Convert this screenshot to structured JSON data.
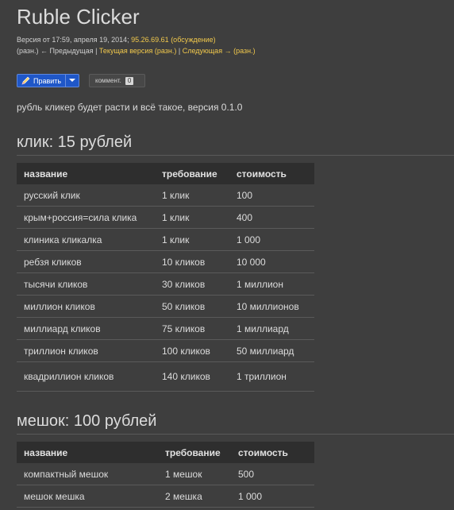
{
  "page": {
    "title": "Ruble Clicker",
    "revision": {
      "prefix": "Версия от 17:59, апреля 19, 2014; ",
      "ip": "95.26.69.61",
      "talk": "(обсуждение)",
      "diff_label": "(разн.)",
      "prev_label": "← Предыдущая",
      "sep1": " | ",
      "current_label": "Текущая версия",
      "current_diff": "(разн.)",
      "sep2": " | ",
      "next_label": "Следующая →",
      "next_diff": "(разн.)"
    },
    "toolbar": {
      "edit_label": "Править",
      "comment_label": "коммент.",
      "comment_count": "0"
    },
    "intro": "рубль кликер будет расти и всё такое, версия 0.1.0"
  },
  "sections": [
    {
      "title": "клик: 15 рублей",
      "headers": [
        "название",
        "требование",
        "стоимость"
      ],
      "rows": [
        [
          "русский клик",
          "1 клик",
          "100"
        ],
        [
          "крым+россия=сила клика",
          "1 клик",
          "400"
        ],
        [
          "клиника кликалка",
          "1 клик",
          "1 000"
        ],
        [
          "ребзя кликов",
          "10 кликов",
          "10 000"
        ],
        [
          "тысячи кликов",
          "30 кликов",
          "1 миллион"
        ],
        [
          "миллион кликов",
          "50 кликов",
          "10 миллионов"
        ],
        [
          "миллиард кликов",
          "75 кликов",
          "1 миллиард"
        ],
        [
          "триллион кликов",
          "100 кликов",
          "50 миллиард"
        ],
        [
          "квадриллион кликов",
          "140 кликов",
          "1 триллион"
        ]
      ]
    },
    {
      "title": "мешок: 100 рублей",
      "headers": [
        "название",
        "требование",
        "стоимость"
      ],
      "rows": [
        [
          "компактный мешок",
          "1 мешок",
          "500"
        ],
        [
          "мешок мешка",
          "2 мешка",
          "1 000"
        ]
      ]
    }
  ],
  "colors": {
    "background": "#3e3e3e",
    "link": "#f2c94c",
    "edit_button": "#1f57c8",
    "table_header": "#2e2e2e"
  }
}
